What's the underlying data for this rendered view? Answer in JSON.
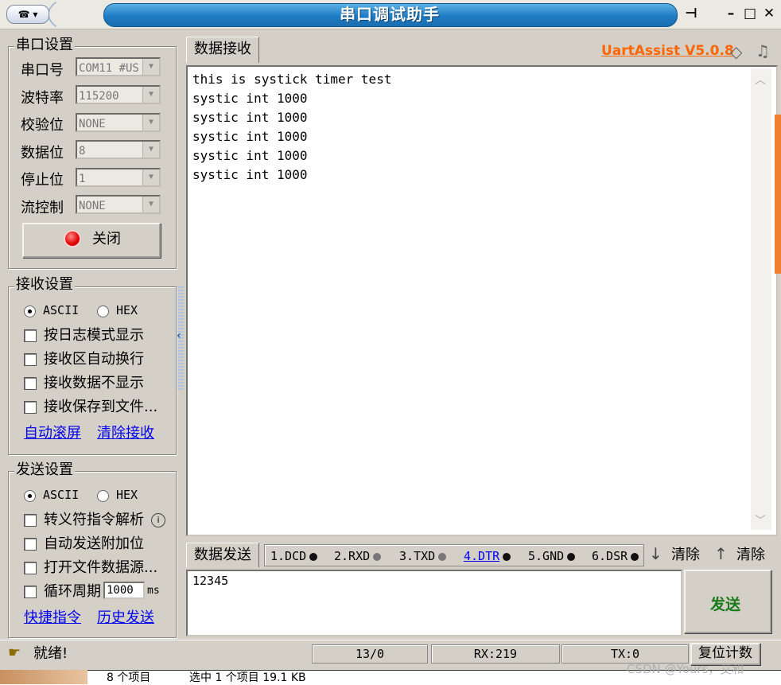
{
  "window": {
    "title": "串口调试助手",
    "sysmenu": "☎ ▾",
    "pin": "⊣",
    "minimize": "–",
    "maximize": "□",
    "close": "✕"
  },
  "serial": {
    "title": "串口设置",
    "port_label": "串口号",
    "port_value": "COM11 #US",
    "baud_label": "波特率",
    "baud_value": "115200",
    "parity_label": "校验位",
    "parity_value": "NONE",
    "databits_label": "数据位",
    "databits_value": "8",
    "stopbits_label": "停止位",
    "stopbits_value": "1",
    "flow_label": "流控制",
    "flow_value": "NONE",
    "close_button": "关闭"
  },
  "recv_settings": {
    "title": "接收设置",
    "ascii": "ASCII",
    "hex": "HEX",
    "opt_log": "按日志模式显示",
    "opt_wrap": "接收区自动换行",
    "opt_hide": "接收数据不显示",
    "opt_save": "接收保存到文件...",
    "link_autoscroll": "自动滚屏",
    "link_clear": "清除接收"
  },
  "send_settings": {
    "title": "发送设置",
    "ascii": "ASCII",
    "hex": "HEX",
    "opt_escape": "转义符指令解析",
    "opt_append": "自动发送附加位",
    "opt_file": "打开文件数据源...",
    "opt_loop": "循环周期",
    "loop_value": "1000",
    "loop_unit": "ms",
    "link_shortcut": "快捷指令",
    "link_history": "历史发送"
  },
  "receive": {
    "tab": "数据接收",
    "brand": "UartAssist V5.0.8",
    "text": "this is systick timer test\nsystic int 1000\nsystic int 1000\nsystic int 1000\nsystic int 1000\nsystic int 1000"
  },
  "send": {
    "tab": "数据发送",
    "signals": [
      "1.DCD",
      "2.RXD",
      "3.TXD",
      "4.DTR",
      "5.GND",
      "6.DSR"
    ],
    "clear1": "清除",
    "clear2": "清除",
    "input_value": "12345",
    "send_button": "发送"
  },
  "status": {
    "ready": "就绪!",
    "count": "13/0",
    "rx": "RX:219",
    "tx": "TX:0",
    "reset": "复位计数"
  },
  "explorer": {
    "items": "8 个项目",
    "selected": "选中 1 个项目  19.1 KB"
  },
  "watermark": "CSDN @Yours，艾和",
  "colors": {
    "title_bar": "#1f7cc4",
    "brand": "#ff6600",
    "send_text": "#1a7a1a",
    "scroll_accent": "#f08030",
    "link": "#0000ee"
  }
}
